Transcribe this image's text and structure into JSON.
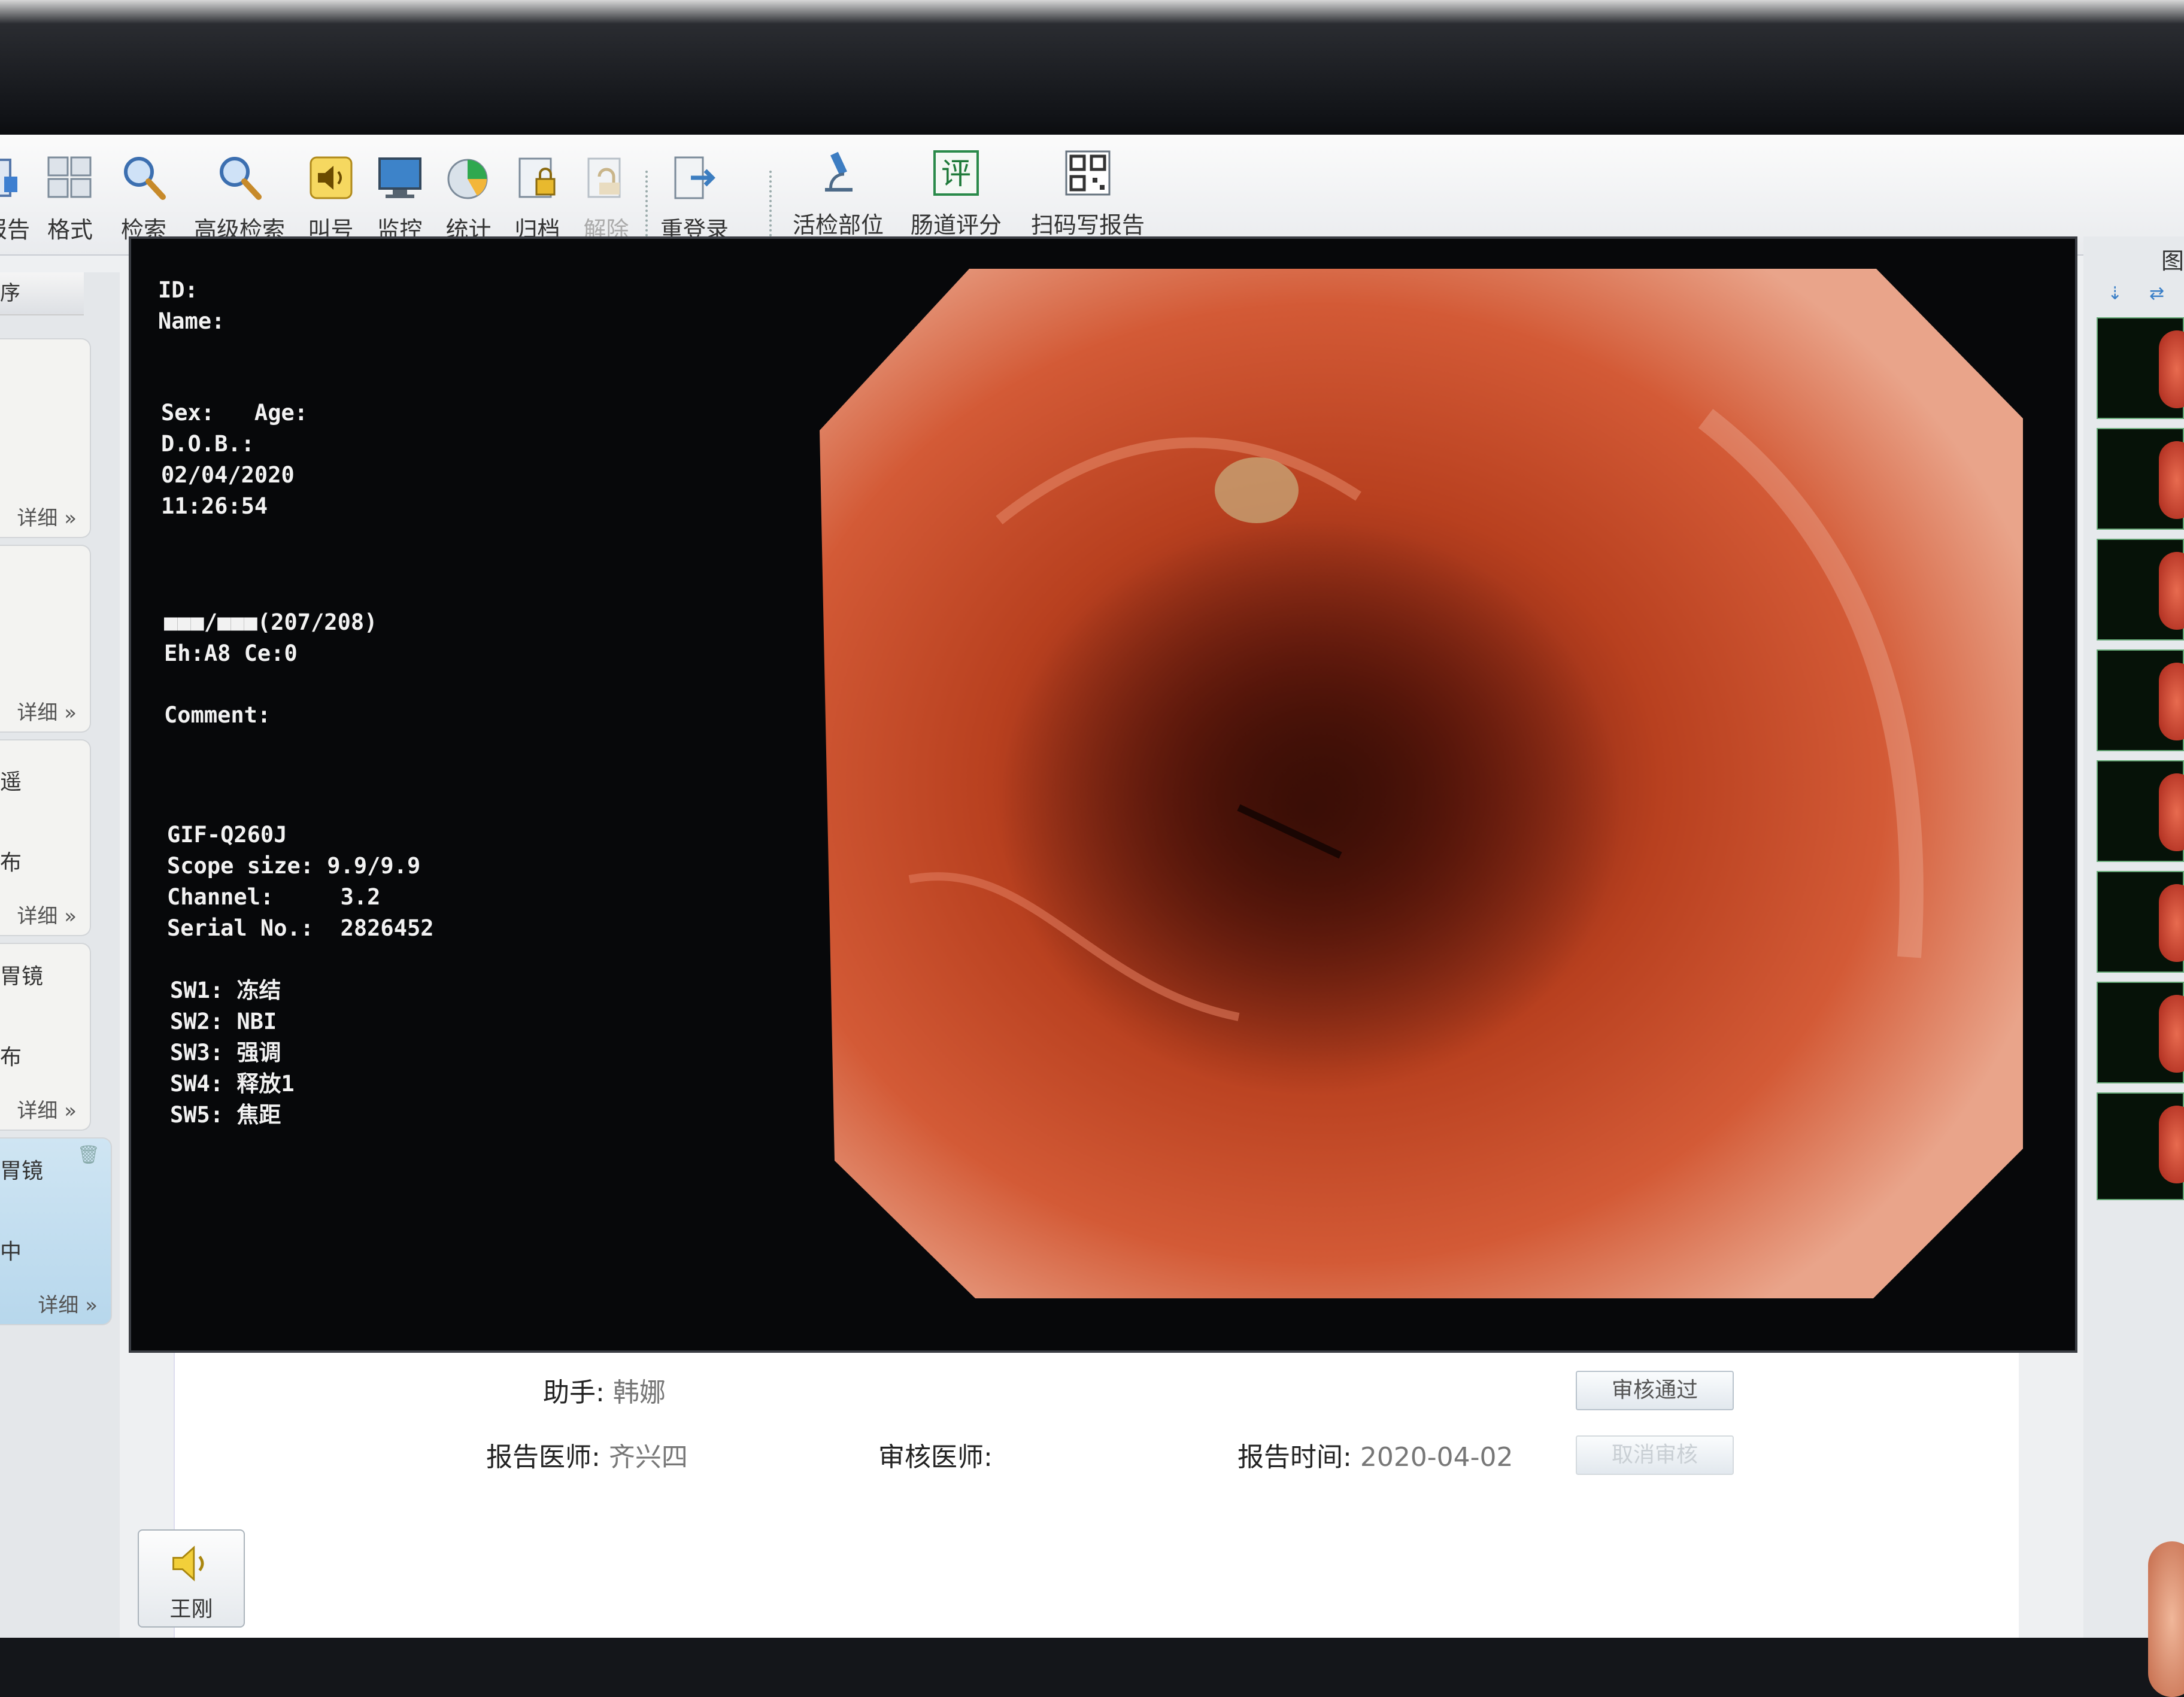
{
  "toolbar": {
    "items": [
      {
        "label": "报告",
        "icon": "report-icon"
      },
      {
        "label": "格式",
        "icon": "grid-layout-icon"
      },
      {
        "label": "检索",
        "icon": "search-icon"
      },
      {
        "label": "高级检索",
        "icon": "advanced-search-icon"
      },
      {
        "label": "叫号",
        "icon": "speaker-icon"
      },
      {
        "label": "监控",
        "icon": "monitor-icon"
      },
      {
        "label": "统计",
        "icon": "pie-chart-icon"
      },
      {
        "label": "归档",
        "icon": "archive-lock-icon"
      },
      {
        "label": "解除",
        "icon": "unarchive-icon"
      },
      {
        "label": "重登录",
        "icon": "relogin-icon"
      },
      {
        "label": "活检部位",
        "icon": "microscope-icon"
      },
      {
        "label": "肠道评分",
        "icon": "score-icon",
        "glyph": "评"
      },
      {
        "label": "扫码写报告",
        "icon": "qr-code-icon"
      }
    ]
  },
  "left_panel": {
    "header": "序",
    "cards": [
      {
        "line1": "",
        "line2": "",
        "detail": "详细 »"
      },
      {
        "line1": "",
        "line2": "",
        "detail": "详细 »"
      },
      {
        "line1": "遥",
        "line2": "布",
        "detail": "详细 »"
      },
      {
        "line1": "胃镜",
        "line2": "布",
        "detail": "详细 »"
      },
      {
        "line1": "胃镜",
        "line2": "中",
        "detail": "详细 »"
      }
    ]
  },
  "osd": {
    "id": "ID:",
    "name": "Name:",
    "sex_age": "Sex:   Age:",
    "dob": "D.O.B.:",
    "date": "02/04/2020",
    "time": "11:26:54",
    "frame": "■■■/■■■(207/208)",
    "enh": "Eh:A8 Ce:0",
    "comment": "Comment:",
    "scope": "GIF-Q260J",
    "scope_size": "Scope size: 9.9/9.9",
    "channel": "Channel:     3.2",
    "serial": "Serial No.:  2826452",
    "sw1": "SW1: 冻结",
    "sw2": "SW2: NBI",
    "sw3": "SW3: 强调",
    "sw4": "SW4: 释放1",
    "sw5": "SW5: 焦距"
  },
  "report": {
    "assistant_label": "助手:",
    "assistant": "韩娜",
    "doctor_label": "报告医师:",
    "doctor": "齐兴四",
    "reviewer_label": "审核医师:",
    "reviewer": "",
    "time_label": "报告时间:",
    "time": "2020-04-02",
    "approve_button": "审核通过",
    "cancel_button": "取消审核"
  },
  "right_panel": {
    "header": "图"
  },
  "call_button": {
    "label": "王刚"
  },
  "colors": {
    "toolbar_bg": "#f1f2f4",
    "osd_text": "#f2f2f2",
    "endoscope_bg": "#07080a",
    "active_card": "#bcd9ee"
  }
}
